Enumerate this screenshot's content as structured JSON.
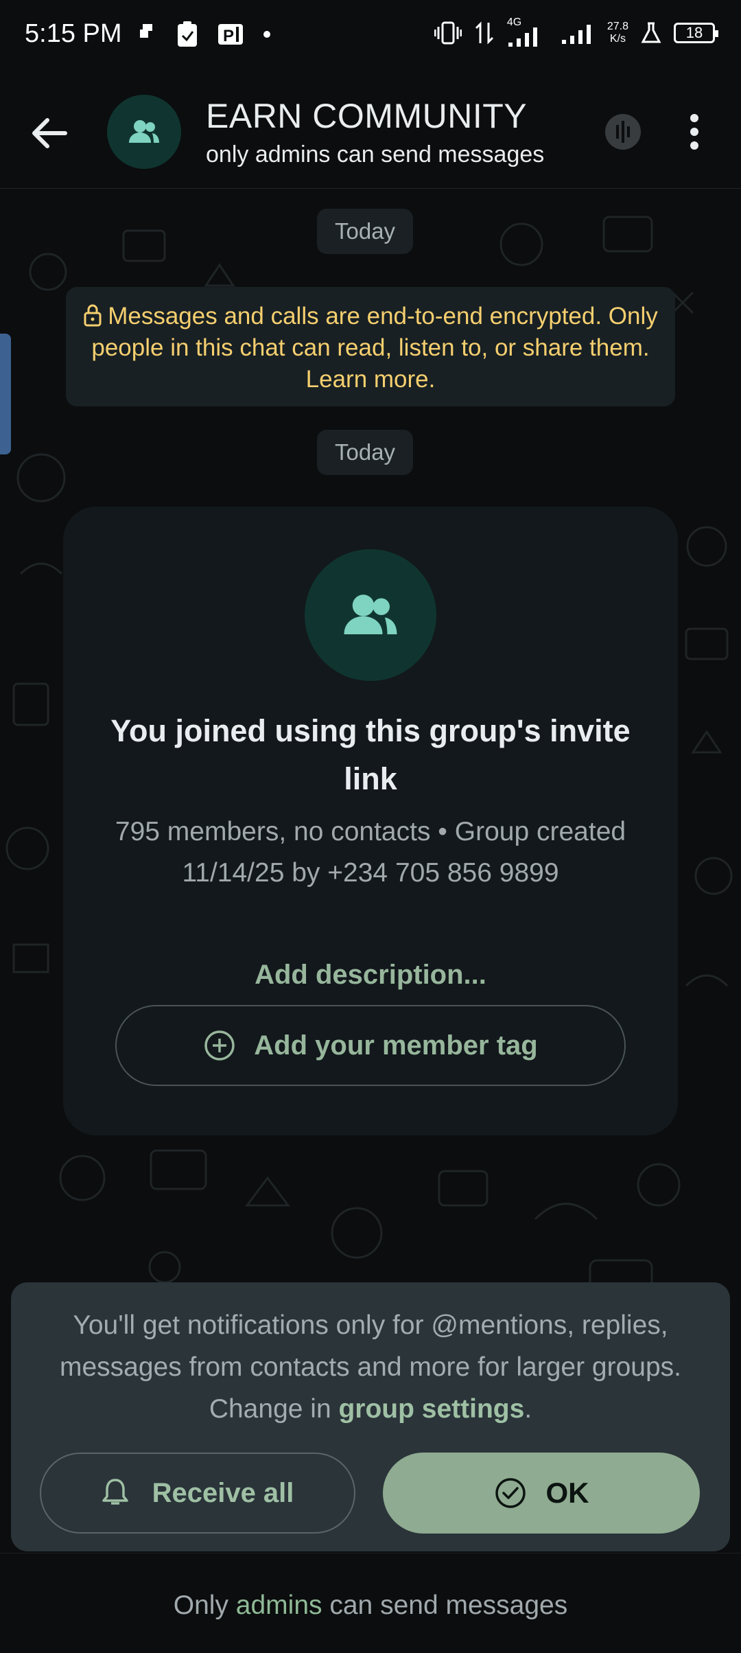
{
  "status_bar": {
    "time": "5:15 PM",
    "network_label": "4G",
    "speed_value": "27.8",
    "speed_unit": "K/s",
    "battery": "18",
    "left_icons": [
      "notification-icon",
      "clipboard-icon",
      "parking-app-icon",
      "dot-icon"
    ],
    "right_icons": [
      "vibrate-icon",
      "data-transfer-icon",
      "signal-icon",
      "signal-icon",
      "lab-icon",
      "battery-icon"
    ]
  },
  "header": {
    "title": "EARN COMMUNITY",
    "subtitle": "only admins can send messages",
    "back_icon": "arrow-left-icon",
    "voice_chat_icon": "voice-chat-icon",
    "menu_icon": "more-vertical-icon"
  },
  "chat": {
    "date_label_1": "Today",
    "encryption_notice": "Messages and calls are end-to-end encrypted. Only people in this chat can read, listen to, or share them. Learn more.",
    "date_label_2": "Today"
  },
  "group_card": {
    "title": "You joined using this group's invite link",
    "meta": "795 members, no contacts • Group created 11/14/25 by +234 705 856 9899",
    "add_description": "Add description...",
    "member_tag_button": "Add your member tag"
  },
  "notification_sheet": {
    "text_before": "You'll get notifications only for @mentions, replies, messages from contacts and more for larger groups. Change in ",
    "link": "group settings",
    "text_after": ".",
    "receive_all_label": "Receive all",
    "ok_label": "OK"
  },
  "footer": {
    "text_before": "Only ",
    "admins": "admins",
    "text_after": " can send messages"
  },
  "colors": {
    "background": "#0b0d0e",
    "accent_green": "#8fab91",
    "encryption_text": "#f6cf6f",
    "avatar_bg": "#103530",
    "avatar_icon": "#7fd3c1"
  }
}
